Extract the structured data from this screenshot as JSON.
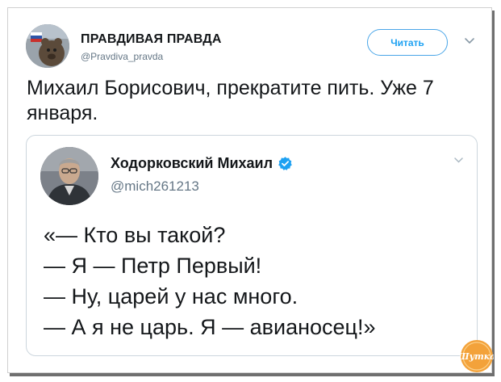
{
  "tweet": {
    "author_name": "ПРАВДИВАЯ ПРАВДА",
    "author_handle": "@Pravdiva_pravda",
    "follow_label": "Читать",
    "text_line_1": "Михаил Борисович, прекратите пить. Уже 7",
    "text_line_2": "января."
  },
  "quoted_tweet": {
    "author_name": "Ходорковский Михаил",
    "author_handle": "@mich261213",
    "verified": true,
    "lines": [
      "«— Кто вы такой?",
      "— Я — Петр Первый!",
      "— Ну, царей у нас много.",
      "— А я не царь. Я — авианосец!»"
    ]
  },
  "watermark": {
    "text": "Шутка"
  },
  "colors": {
    "accent": "#1da1f2",
    "text": "#14171a",
    "muted": "#657786",
    "border": "#ccd6dd",
    "watermark": "#f3a23a"
  },
  "icons": {
    "menu_caret": "chevron-down-icon",
    "verified_badge": "verified-badge-icon"
  }
}
